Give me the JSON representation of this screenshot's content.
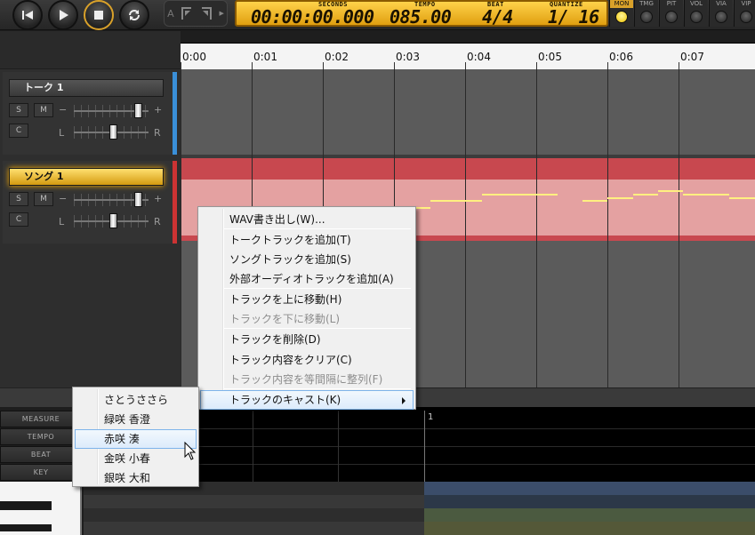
{
  "toolbar": {
    "buttons": [
      {
        "name": "rewind-button",
        "icon": "skip-back-icon"
      },
      {
        "name": "play-button",
        "icon": "play-icon"
      },
      {
        "name": "stop-button",
        "icon": "stop-icon"
      },
      {
        "name": "loop-button",
        "icon": "loop-icon"
      }
    ],
    "align_prefix": "A"
  },
  "lcd": {
    "seconds_label": "SECONDS",
    "seconds": "00:00:00.000",
    "tempo_label": "TEMPO",
    "tempo": "085.00",
    "beat_label": "BEAT",
    "beat": "4/4",
    "quantize_label": "QUANTIZE",
    "quantize": "1/ 16"
  },
  "indicators": [
    {
      "label": "MON",
      "active": true
    },
    {
      "label": "TMG",
      "active": false
    },
    {
      "label": "PIT",
      "active": false
    },
    {
      "label": "VOL",
      "active": false
    },
    {
      "label": "VIA",
      "active": false
    },
    {
      "label": "VIP",
      "active": false
    }
  ],
  "ruler": {
    "ticks": [
      "0:00",
      "0:01",
      "0:02",
      "0:03",
      "0:04",
      "0:05",
      "0:06",
      "0:07"
    ]
  },
  "tracks": [
    {
      "name": "トーク 1",
      "type": "talk",
      "solo_label": "S",
      "mute_label": "M",
      "cast_label": "C",
      "vol_minus": "−",
      "vol_plus": "+",
      "pan_left": "L",
      "pan_right": "R",
      "volume": 0.85,
      "pan": 0.5
    },
    {
      "name": "ソング 1",
      "type": "song",
      "solo_label": "S",
      "mute_label": "M",
      "cast_label": "C",
      "vol_minus": "−",
      "vol_plus": "+",
      "pan_left": "L",
      "pan_right": "R",
      "volume": 0.85,
      "pan": 0.5
    }
  ],
  "bottom_editor": {
    "labels": [
      "MEASURE",
      "TEMPO",
      "BEAT",
      "KEY"
    ],
    "measure_marker": "1"
  },
  "context_menu": {
    "items": [
      {
        "label": "WAV書き出し(W)...",
        "enabled": true
      },
      {
        "label": "トークトラックを追加(T)",
        "enabled": true
      },
      {
        "label": "ソングトラックを追加(S)",
        "enabled": true
      },
      {
        "label": "外部オーディオトラックを追加(A)",
        "enabled": true
      },
      {
        "label": "トラックを上に移動(H)",
        "enabled": true
      },
      {
        "label": "トラックを下に移動(L)",
        "enabled": false
      },
      {
        "label": "トラックを削除(D)",
        "enabled": true
      },
      {
        "label": "トラック内容をクリア(C)",
        "enabled": true
      },
      {
        "label": "トラック内容を等間隔に整列(F)",
        "enabled": false
      },
      {
        "label": "トラックのキャスト(K)",
        "enabled": true,
        "submenu": true
      }
    ]
  },
  "cast_submenu": {
    "items": [
      "さとうささら",
      "緑咲 香澄",
      "赤咲 湊",
      "金咲 小春",
      "銀咲 大和"
    ],
    "highlighted": "赤咲 湊"
  },
  "colors": {
    "accent": "#d9a12a",
    "talk_track": "#3a8fd8",
    "song_track": "#c8484f",
    "note": "#fff080"
  }
}
